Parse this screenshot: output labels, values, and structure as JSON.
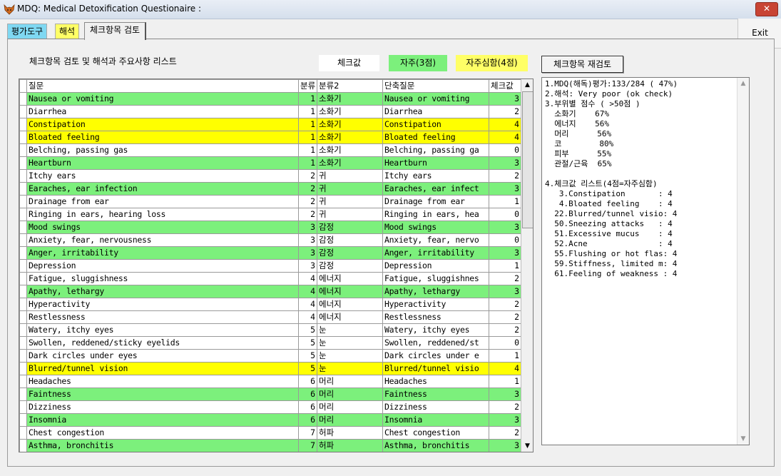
{
  "window": {
    "title": "MDQ: Medical Detoxification Questionaire :",
    "close_label": "✕"
  },
  "exit_label": "Exit",
  "tabs": [
    {
      "label": "평가도구",
      "color": "#7fd8f2"
    },
    {
      "label": "해석",
      "color": "#ffff66"
    },
    {
      "label": "체크항목 검토",
      "color": "#f0f0f0",
      "active": true
    }
  ],
  "heading": "체크항목 검토 및 해석과 주요사항 리스트",
  "legend": {
    "check": "체크값",
    "often": "자주(3점)",
    "severe": "자주심함(4점)"
  },
  "colors": {
    "often": "#7cf07c",
    "severe": "#ffff00"
  },
  "recheck_label": "체크항목 재검토",
  "grid": {
    "headers": [
      "질문",
      "분류",
      "분류2",
      "단축질문",
      "체크값"
    ],
    "rows": [
      [
        "Nausea or vomiting",
        "1",
        "소화기",
        "Nausea or vomiting",
        "3"
      ],
      [
        "Diarrhea",
        "1",
        "소화기",
        "Diarrhea",
        "2"
      ],
      [
        "Constipation",
        "1",
        "소화기",
        "Constipation",
        "4"
      ],
      [
        "Bloated feeling",
        "1",
        "소화기",
        "Bloated feeling",
        "4"
      ],
      [
        "Belching, passing gas",
        "1",
        "소화기",
        "Belching, passing ga",
        "0"
      ],
      [
        "Heartburn",
        "1",
        "소화기",
        "Heartburn",
        "3"
      ],
      [
        "Itchy ears",
        "2",
        "귀",
        "Itchy ears",
        "2"
      ],
      [
        "Earaches, ear infection",
        "2",
        "귀",
        "Earaches, ear infect",
        "3"
      ],
      [
        "Drainage from ear",
        "2",
        "귀",
        "Drainage from ear",
        "1"
      ],
      [
        "Ringing in ears, hearing loss",
        "2",
        "귀",
        "Ringing in ears, hea",
        "0"
      ],
      [
        "Mood swings",
        "3",
        "감정",
        "Mood swings",
        "3"
      ],
      [
        "Anxiety, fear, nervousness",
        "3",
        "감정",
        "Anxiety, fear, nervo",
        "0"
      ],
      [
        "Anger, irritability",
        "3",
        "감정",
        "Anger, irritability",
        "3"
      ],
      [
        "Depression",
        "3",
        "감정",
        "Depression",
        "1"
      ],
      [
        "Fatigue, sluggishness",
        "4",
        "에너지",
        "Fatigue, sluggishnes",
        "2"
      ],
      [
        "Apathy, lethargy",
        "4",
        "에너지",
        "Apathy, lethargy",
        "3"
      ],
      [
        "Hyperactivity",
        "4",
        "에너지",
        "Hyperactivity",
        "2"
      ],
      [
        "Restlessness",
        "4",
        "에너지",
        "Restlessness",
        "2"
      ],
      [
        "Watery, itchy eyes",
        "5",
        "눈",
        "Watery, itchy eyes",
        "2"
      ],
      [
        "Swollen, reddened/sticky eyelids",
        "5",
        "눈",
        "Swollen, reddened/st",
        "0"
      ],
      [
        "Dark circles under eyes",
        "5",
        "눈",
        "Dark circles under e",
        "1"
      ],
      [
        "Blurred/tunnel vision",
        "5",
        "눈",
        "Blurred/tunnel visio",
        "4"
      ],
      [
        "Headaches",
        "6",
        "머리",
        "Headaches",
        "1"
      ],
      [
        "Faintness",
        "6",
        "머리",
        "Faintness",
        "3"
      ],
      [
        "Dizziness",
        "6",
        "머리",
        "Dizziness",
        "2"
      ],
      [
        "Insomnia",
        "6",
        "머리",
        "Insomnia",
        "3"
      ],
      [
        "Chest congestion",
        "7",
        "허파",
        "Chest congestion",
        "2"
      ],
      [
        "Asthma, bronchitis",
        "7",
        "허파",
        "Asthma, bronchitis",
        "3"
      ]
    ]
  },
  "result_lines": [
    "1.MDQ(해독)평가:133/284 ( 47%)",
    "2.해석: Very poor (ok check)",
    "3.부위별 점수 ( >50점 )",
    "  소화기    67%",
    "  에너지    56%",
    "  머리      56%",
    "  코        80%",
    "  피부      55%",
    "  관절/근육  65%",
    "",
    "4.체크값 리스트(4점=자주심함)",
    "   3.Constipation       : 4",
    "   4.Bloated feeling    : 4",
    "  22.Blurred/tunnel visio: 4",
    "  50.Sneezing attacks   : 4",
    "  51.Excessive mucus    : 4",
    "  52.Acne               : 4",
    "  55.Flushing or hot flas: 4",
    "  59.Stiffness, limited m: 4",
    "  61.Feeling of weakness : 4"
  ]
}
